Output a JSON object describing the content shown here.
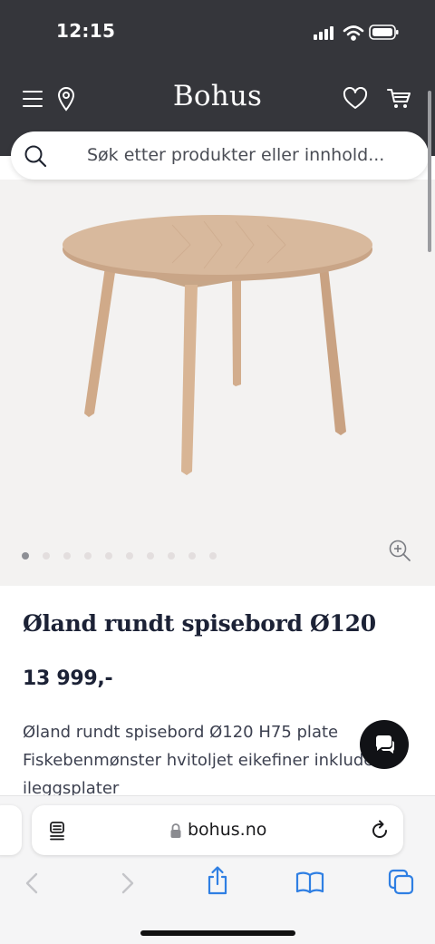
{
  "status_bar": {
    "time": "12:15"
  },
  "header": {
    "brand": "Bohus",
    "icons": [
      "menu-icon",
      "location-pin-icon",
      "heart-icon",
      "cart-icon"
    ]
  },
  "search": {
    "placeholder": "Søk etter produkter eller innhold..."
  },
  "gallery": {
    "image_count": 10,
    "active_index": 0
  },
  "product": {
    "title": "Øland rundt spisebord Ø120",
    "price": "13 999,-",
    "description": "Øland rundt spisebord Ø120 H75 plate Fiskebenmønster hvitoljet eikefiner inkludert ileggsplater"
  },
  "browser": {
    "url": "bohus.no",
    "toolbar_icons": [
      "back-icon",
      "forward-icon",
      "share-icon",
      "bookmarks-icon",
      "tabs-icon"
    ]
  },
  "colors": {
    "header_bg": "#35363b",
    "gallery_bg": "#f3f2f1",
    "title_color": "#1c2236",
    "safari_blue": "#2f7fe3"
  }
}
